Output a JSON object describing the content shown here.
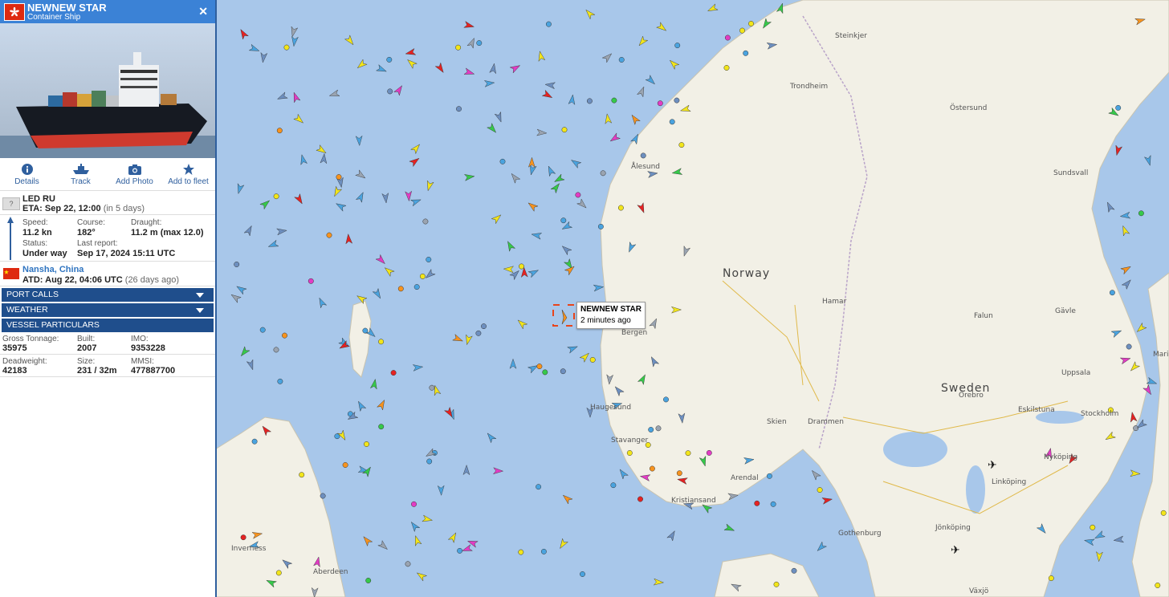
{
  "vessel": {
    "name": "NEWNEW STAR",
    "type": "Container Ship",
    "flag_color": "#de2910"
  },
  "actions": [
    {
      "label": "Details",
      "icon": "info-icon"
    },
    {
      "label": "Track",
      "icon": "ship-icon"
    },
    {
      "label": "Add Photo",
      "icon": "camera-icon"
    },
    {
      "label": "Add to fleet",
      "icon": "star-icon"
    }
  ],
  "destination": {
    "code": "LED RU",
    "eta_label": "ETA:",
    "eta": "Sep 22, 12:00",
    "eta_rel": "(in 5 days)"
  },
  "nav": {
    "speed_label": "Speed:",
    "speed": "11.2 kn",
    "course_label": "Course:",
    "course": "182°",
    "draught_label": "Draught:",
    "draught": "11.2 m (max 12.0)",
    "status_label": "Status:",
    "status": "Under way",
    "report_label": "Last report:",
    "report": "Sep 17, 2024 15:11 UTC"
  },
  "origin": {
    "port": "Nansha, China",
    "atd_label": "ATD:",
    "atd": "Aug 22, 04:06 UTC",
    "atd_rel": "(26 days ago)"
  },
  "sections": {
    "port_calls": "PORT CALLS",
    "weather": "WEATHER",
    "particulars": "VESSEL PARTICULARS"
  },
  "particulars": {
    "gt_label": "Gross Tonnage:",
    "gt": "35975",
    "built_label": "Built:",
    "built": "2007",
    "imo_label": "IMO:",
    "imo": "9353228",
    "dwt_label": "Deadweight:",
    "dwt": "42183",
    "size_label": "Size:",
    "size": "231 / 32m",
    "mmsi_label": "MMSI:",
    "mmsi": "477887700"
  },
  "tooltip": {
    "name": "NEWNEW STAR",
    "time": "2 minutes ago"
  },
  "map_labels": {
    "norway": "Norway",
    "sweden": "Sweden",
    "steinkjer": "Steinkjer",
    "trondheim": "Trondheim",
    "ostersund": "Östersund",
    "sundsvall": "Sundsvall",
    "alesund": "Ålesund",
    "hamar": "Hamar",
    "falun": "Falun",
    "bergen": "Bergen",
    "uppsala": "Uppsala",
    "haugesund": "Haugesund",
    "skien": "Skien",
    "drammen": "Drammen",
    "stavanger": "Stavanger",
    "orebro": "Örebro",
    "eskilstuna": "Eskilstuna",
    "stockholm": "Stockholm",
    "nykoping": "Nyköping",
    "linkoping": "Linköping",
    "arendal": "Arendal",
    "kristiansand": "Kristiansand",
    "jonkoping": "Jönköping",
    "gothenburg": "Gothenburg",
    "inverness": "Inverness",
    "aberdeen": "Aberdeen",
    "vaxjo": "Växjö",
    "gavle": "Gävle",
    "mariehamn": "Mari"
  },
  "colors": {
    "sea": "#a8c7ea",
    "land": "#f2f0e6",
    "header": "#3b82d6",
    "section": "#1f4e8c"
  }
}
